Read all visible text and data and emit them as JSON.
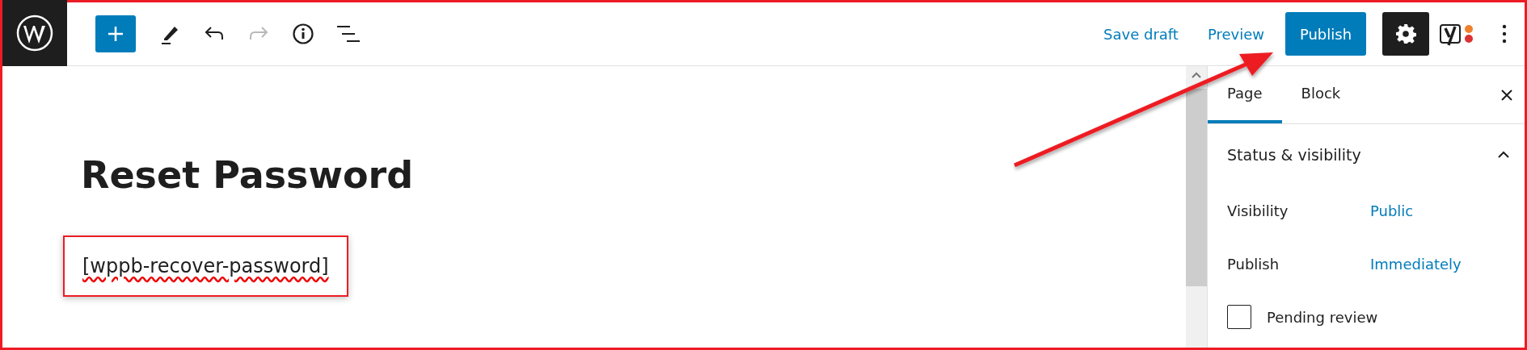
{
  "toolbar": {
    "tools": [
      {
        "kind": "add",
        "disabled": false
      },
      {
        "kind": "edit",
        "disabled": false
      },
      {
        "kind": "undo",
        "disabled": false
      },
      {
        "kind": "redo",
        "disabled": true
      },
      {
        "kind": "info",
        "disabled": false
      },
      {
        "kind": "outline",
        "disabled": false
      }
    ],
    "save_draft": "Save draft",
    "preview": "Preview",
    "publish": "Publish",
    "settings_active": true
  },
  "editor": {
    "title": "Reset Password",
    "shortcode": "[wppb-recover-password]",
    "highlighted": true
  },
  "sidebar": {
    "tabs": [
      {
        "label": "Page",
        "selected": true
      },
      {
        "label": "Block",
        "selected": false
      }
    ],
    "panel": {
      "title": "Status & visibility",
      "expanded": true,
      "rows": [
        {
          "label": "Visibility",
          "value": "Public"
        },
        {
          "label": "Publish",
          "value": "Immediately"
        }
      ],
      "pending_review": {
        "label": "Pending review",
        "checked": false
      }
    }
  }
}
